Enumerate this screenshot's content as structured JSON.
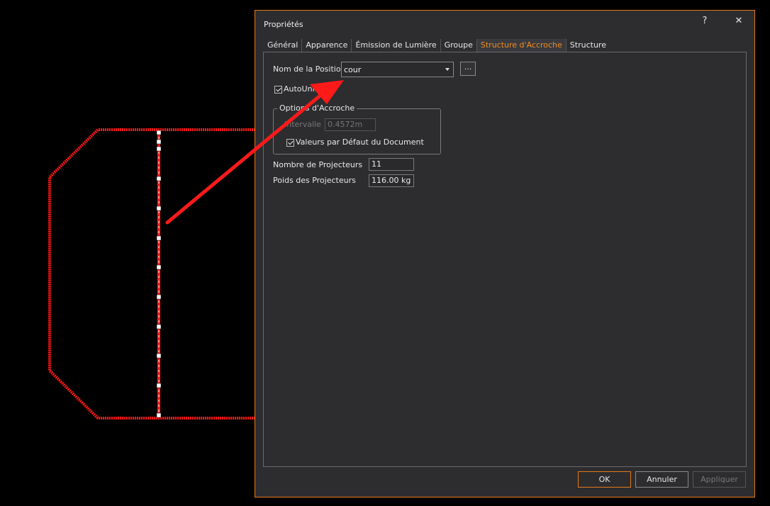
{
  "dialog": {
    "title": "Propriétés",
    "help_label": "?",
    "close_label": "✕",
    "tabs": [
      {
        "label": "Général"
      },
      {
        "label": "Apparence"
      },
      {
        "label": "Émission de Lumière"
      },
      {
        "label": "Groupe"
      },
      {
        "label": "Structure d'Accroche"
      },
      {
        "label": "Structure"
      }
    ],
    "active_tab": "Structure d'Accroche",
    "position_name_label": "Nom de la Position",
    "position_name_value": "cour",
    "browse_label": "...",
    "autounit_label": "AutoUnit",
    "autounit_checked": true,
    "hanging_options_label": "Options d'Accroche",
    "interval_label": "Intervalle",
    "interval_value": "0.4572m",
    "document_defaults_label": "Valeurs par Défaut du Document",
    "document_defaults_checked": true,
    "fixture_count_label": "Nombre de Projecteurs",
    "fixture_count_value": "11",
    "fixture_weight_label": "Poids des Projecteurs",
    "fixture_weight_value": "116.00 kg",
    "ok_label": "OK",
    "cancel_label": "Annuler",
    "apply_label": "Appliquer"
  },
  "colors": {
    "accent": "#e5791a",
    "active_tab_text": "#f28c1a",
    "drawing_red": "#ff1a1a",
    "dialog_bg": "#2d2d30"
  }
}
